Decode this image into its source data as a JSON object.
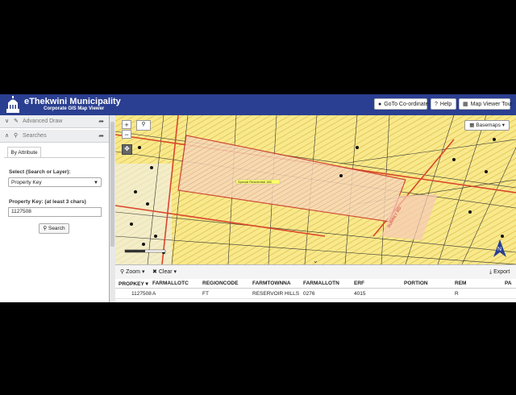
{
  "header": {
    "title": "eThekwini Municipality",
    "subtitle": "Corporate GIS Map Viewer",
    "goto_label": "GoTo Co-ordinate",
    "help_label": "Help",
    "tour_label": "Map Viewer Tour",
    "bg_color": "#2a3f91"
  },
  "panel": {
    "advanced_draw": "Advanced Draw",
    "searches": "Searches",
    "tab_attribute": "By Attribute",
    "select_label": "Select (Search or Layer):",
    "select_value": "Property Key",
    "key_label": "Property Key: (at least 3 chars)",
    "key_value": "1127508",
    "search_button": "Search"
  },
  "map": {
    "basemaps_label": "Basemaps",
    "highlight_label": "Special Residential 180",
    "north_label": "N",
    "road_label": "SURREY RD",
    "icons": [
      "zoom-in-icon",
      "zoom-out-icon",
      "magnifier-icon",
      "pan-icon",
      "grid-icon",
      "north-arrow-icon"
    ]
  },
  "table": {
    "zoom_label": "Zoom",
    "clear_label": "Clear",
    "export_label": "Export",
    "columns": [
      "PROPKEY",
      "FARMALLOTC",
      "REGIONCODE",
      "FARMTOWNNA",
      "FARMALLOTN",
      "ERF",
      "PORTION",
      "REM",
      "PA"
    ],
    "row": [
      "1127508",
      "A",
      "FT",
      "RESERVOIR HILLS",
      "0276",
      "4015",
      "",
      "R",
      ""
    ]
  }
}
